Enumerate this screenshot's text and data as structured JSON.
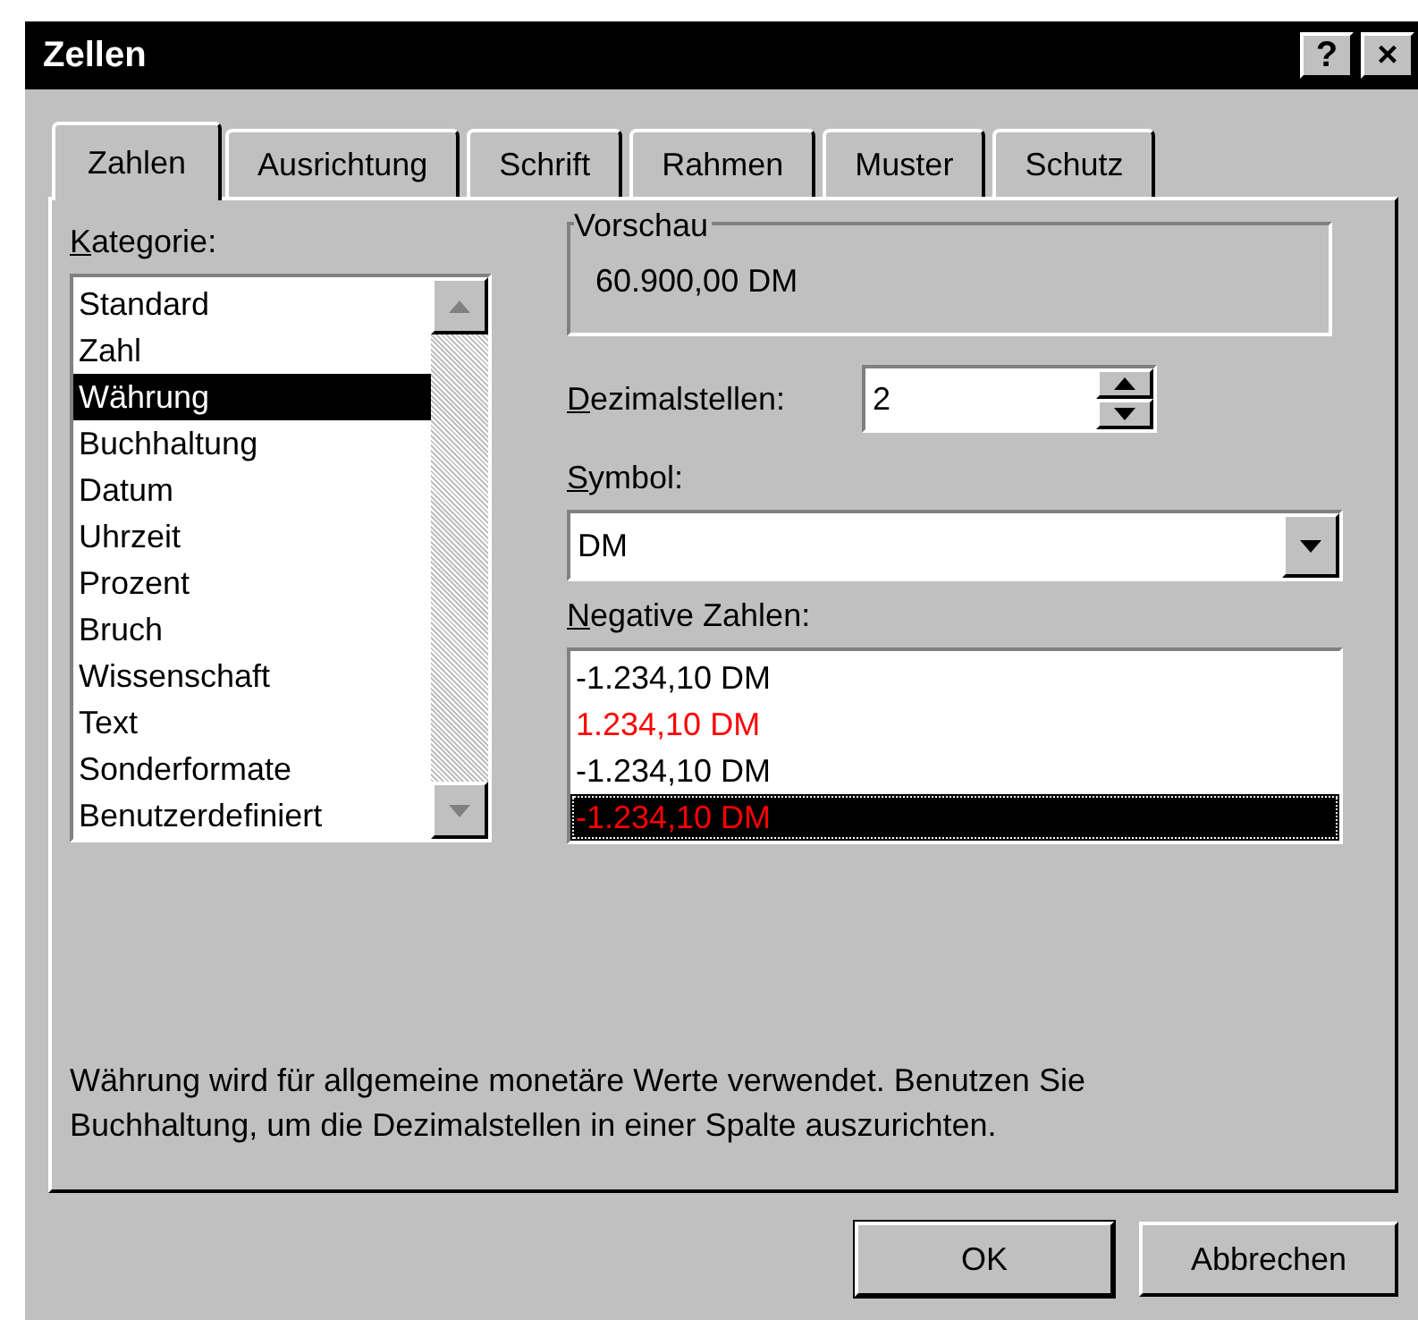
{
  "window": {
    "title": "Zellen",
    "title_buttons": [
      "?",
      "×"
    ]
  },
  "tabs": [
    {
      "label": "Zahlen",
      "selected": true
    },
    {
      "label": "Ausrichtung",
      "selected": false
    },
    {
      "label": "Schrift",
      "selected": false
    },
    {
      "label": "Rahmen",
      "selected": false
    },
    {
      "label": "Muster",
      "selected": false
    },
    {
      "label": "Schutz",
      "selected": false
    }
  ],
  "category": {
    "access_key": "K",
    "label_rest": "ategorie:",
    "items": [
      {
        "label": "Standard",
        "selected": false
      },
      {
        "label": "Zahl",
        "selected": false
      },
      {
        "label": "Währung",
        "selected": true
      },
      {
        "label": "Buchhaltung",
        "selected": false
      },
      {
        "label": "Datum",
        "selected": false
      },
      {
        "label": "Uhrzeit",
        "selected": false
      },
      {
        "label": "Prozent",
        "selected": false
      },
      {
        "label": "Bruch",
        "selected": false
      },
      {
        "label": "Wissenschaft",
        "selected": false
      },
      {
        "label": "Text",
        "selected": false
      },
      {
        "label": "Sonderformate",
        "selected": false
      },
      {
        "label": "Benutzerdefiniert",
        "selected": false
      }
    ]
  },
  "preview": {
    "title": "Vorschau",
    "value": "60.900,00 DM"
  },
  "decimals": {
    "access_key": "D",
    "label_rest": "ezimalstellen:",
    "value": "2"
  },
  "symbol": {
    "access_key": "S",
    "label_rest": "ymbol:",
    "value": "DM"
  },
  "negative_numbers": {
    "access_key": "N",
    "label_rest": "egative Zahlen:",
    "items": [
      {
        "label": "-1.234,10 DM",
        "color": "#000000",
        "selected": false
      },
      {
        "label": "1.234,10 DM",
        "color": "#ff0000",
        "selected": false
      },
      {
        "label": "-1.234,10 DM",
        "color": "#000000",
        "selected": false
      },
      {
        "label": "-1.234,10 DM",
        "color": "#ff0000",
        "selected": true
      }
    ]
  },
  "description": "Währung wird für allgemeine monetäre Werte verwendet. Benutzen Sie Buchhaltung, um die Dezimalstellen in einer Spalte auszurichten.",
  "buttons": [
    "OK",
    "Abbrechen"
  ]
}
